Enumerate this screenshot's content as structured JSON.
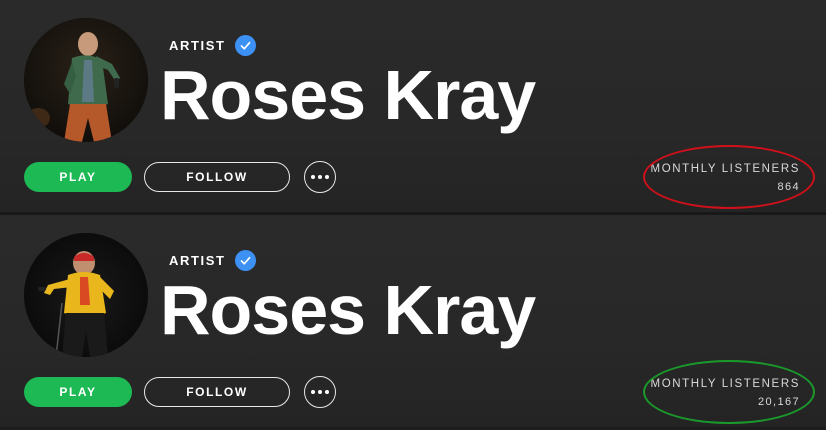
{
  "profiles": [
    {
      "artist_label": "ARTIST",
      "name": "Roses Kray",
      "play_label": "PLAY",
      "follow_label": "FOLLOW",
      "listeners_label": "MONTHLY LISTENERS",
      "listeners_count": "864",
      "annotation_color": "#d0101a"
    },
    {
      "artist_label": "ARTIST",
      "name": "Roses Kray",
      "play_label": "PLAY",
      "follow_label": "FOLLOW",
      "listeners_label": "MONTHLY LISTENERS",
      "listeners_count": "20,167",
      "annotation_color": "#1a9a2a"
    }
  ],
  "icons": {
    "verified": "verified-badge-icon",
    "more": "more-options-icon"
  },
  "colors": {
    "play_button": "#1db954",
    "verified_badge": "#3d91f4",
    "background": "#282828"
  }
}
